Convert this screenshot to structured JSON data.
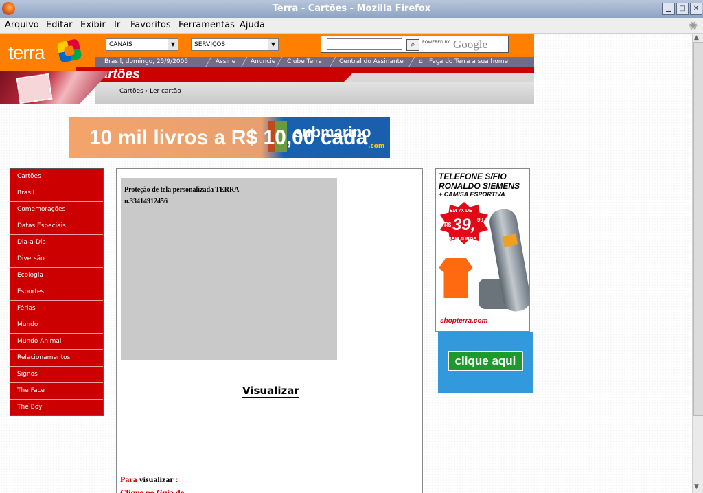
{
  "window": {
    "title": "Terra - Cartões - Mozilla Firefox",
    "buttons": [
      "minimize",
      "maximize",
      "close"
    ]
  },
  "menu": [
    "Arquivo",
    "Editar",
    "Exibir",
    "Ir",
    "Favoritos",
    "Ferramentas",
    "Ajuda"
  ],
  "header": {
    "logo_text": "terra",
    "canais": "CANAIS",
    "servicos": "SERVIÇOS",
    "search_value": "",
    "powered_by": "POWERED BY",
    "google": "Google",
    "date": "Brasil, domingo, 25/9/2005",
    "links": [
      "Assine",
      "Anuncie",
      "Clube Terra",
      "Central do Assinante",
      "Faça do Terra a sua home"
    ],
    "section": "cartões",
    "breadcrumb": "Cartões › Ler cartão"
  },
  "banner": {
    "text": "10 mil livros a R$ 10,00 cada",
    "brand": "submarino",
    "brand_suffix": ".com"
  },
  "sidebar": {
    "items": [
      "Cartões",
      "Brasil",
      "Comemorações",
      "Datas Especiais",
      "Dia-a-Dia",
      "Diversão",
      "Ecologia",
      "Esportes",
      "Férias",
      "Mundo",
      "Mundo Animal",
      "Relacionamentos",
      "Signos",
      "The Face",
      "The Boy"
    ]
  },
  "card": {
    "line1": "Proteção de tela personalizada TERRA",
    "line2": "n.33414912456",
    "visualizar": "Visualizar",
    "para": "Para",
    "para_link": "visualizar",
    "para_suffix": " :",
    "clique": "Clique no Guia de"
  },
  "ads": {
    "phone_title1": "TELEFONE S/FIO",
    "phone_title2": "RONALDO SIEMENS",
    "phone_sub": "+ CAMISA ESPORTIVA",
    "price_pre": "EM 7X DE",
    "price_currency": "R$",
    "price_int": "39,",
    "price_dec": "99",
    "price_post": "SEM JUROS",
    "shop": "shopterra.com",
    "clique_aqui": "clique aqui"
  },
  "colors": {
    "terra_orange": "#ff7f00",
    "terra_red": "#cc0000",
    "nav_purple": "#6e6e8c",
    "preview_gray": "#c9c9c9",
    "ad_blue": "#3399dd",
    "ad_green": "#1e9a2c"
  }
}
